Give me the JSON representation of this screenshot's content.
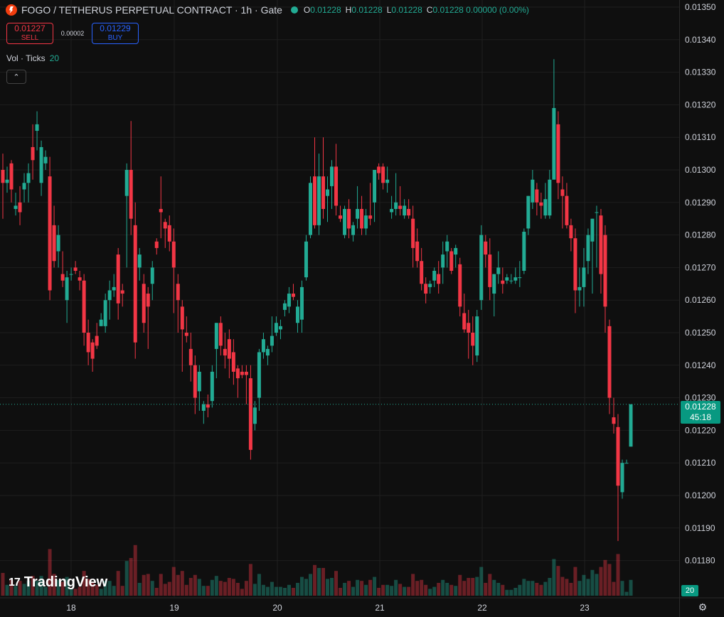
{
  "header": {
    "title": "FOGO / TETHERUS PERPETUAL CONTRACT · 1h · Gate",
    "ohlc": [
      {
        "label": "O",
        "value": "0.01228"
      },
      {
        "label": "H",
        "value": "0.01228"
      },
      {
        "label": "L",
        "value": "0.01228"
      },
      {
        "label": "C",
        "value": "0.01228 0.00000 (0.00%)"
      }
    ]
  },
  "trade": {
    "sell_price": "0.01227",
    "sell_label": "SELL",
    "spread": "0.00002",
    "buy_price": "0.01229",
    "buy_label": "BUY"
  },
  "indicator": {
    "name": "Vol · Ticks",
    "value": "20"
  },
  "collapse_icon": "chevron-up-icon",
  "logo": {
    "mark": "17",
    "text": "TradingView"
  },
  "last_price": {
    "price": "0.01228",
    "countdown": "45:18"
  },
  "volume_badge": "20",
  "settings_icon": "gear-icon",
  "colors": {
    "up": "#22ab94",
    "down": "#f23645",
    "background": "#0f0f0f",
    "grid": "#1f1f1f"
  },
  "chart_data": {
    "type": "candlestick",
    "price_axis": [
      "0.01350",
      "0.01340",
      "0.01330",
      "0.01320",
      "0.01310",
      "0.01300",
      "0.01290",
      "0.01280",
      "0.01270",
      "0.01260",
      "0.01250",
      "0.01240",
      "0.01230",
      "0.01220",
      "0.01210",
      "0.01200",
      "0.01190",
      "0.01180"
    ],
    "ylim": [
      0.01172,
      0.01352
    ],
    "time_axis": [
      "18",
      "19",
      "20",
      "21",
      "22",
      "23"
    ],
    "candles": [
      [
        0.013,
        0.01305,
        0.01285,
        0.01296
      ],
      [
        0.01296,
        0.01301,
        0.01293,
        0.01297
      ],
      [
        0.01302,
        0.01303,
        0.0129,
        0.01294
      ],
      [
        0.01288,
        0.01293,
        0.01286,
        0.01289
      ],
      [
        0.0129,
        0.01295,
        0.01283,
        0.01287
      ],
      [
        0.01294,
        0.01299,
        0.0129,
        0.01296
      ],
      [
        0.01296,
        0.01302,
        0.0129,
        0.01299
      ],
      [
        0.01307,
        0.01314,
        0.01297,
        0.01303
      ],
      [
        0.01312,
        0.01318,
        0.01306,
        0.01314
      ],
      [
        0.01296,
        0.01309,
        0.01292,
        0.01307
      ],
      [
        0.01302,
        0.01306,
        0.013,
        0.01304
      ],
      [
        0.01298,
        0.01304,
        0.0126,
        0.01263
      ],
      [
        0.01283,
        0.01289,
        0.0127,
        0.01272
      ],
      [
        0.01275,
        0.01283,
        0.0127,
        0.0128
      ],
      [
        0.01268,
        0.01275,
        0.01264,
        0.01266
      ],
      [
        0.0126,
        0.01269,
        0.01253,
        0.01267
      ],
      [
        0.01268,
        0.0127,
        0.01266,
        0.01268
      ],
      [
        0.0127,
        0.01272,
        0.01268,
        0.01269
      ],
      [
        0.01267,
        0.01269,
        0.01263,
        0.01266
      ],
      [
        0.01266,
        0.01268,
        0.01246,
        0.0125
      ],
      [
        0.0125,
        0.01254,
        0.0124,
        0.01244
      ],
      [
        0.01247,
        0.01248,
        0.01238,
        0.01242
      ],
      [
        0.01249,
        0.01253,
        0.01245,
        0.01246
      ],
      [
        0.01252,
        0.01256,
        0.01252,
        0.01254
      ],
      [
        0.01252,
        0.01262,
        0.0125,
        0.0126
      ],
      [
        0.0126,
        0.01266,
        0.01254,
        0.01263
      ],
      [
        0.01263,
        0.01268,
        0.01261,
        0.01264
      ],
      [
        0.01274,
        0.01276,
        0.01254,
        0.01259
      ],
      [
        0.01263,
        0.01265,
        0.01258,
        0.01262
      ],
      [
        0.01292,
        0.01302,
        0.0127,
        0.013
      ],
      [
        0.013,
        0.01315,
        0.0128,
        0.01285
      ],
      [
        0.01283,
        0.0129,
        0.01242,
        0.01247
      ],
      [
        0.0127,
        0.01276,
        0.01266,
        0.01274
      ],
      [
        0.01265,
        0.01268,
        0.0125,
        0.01253
      ],
      [
        0.01262,
        0.01264,
        0.01245,
        0.01258
      ],
      [
        0.01265,
        0.01272,
        0.0126,
        0.0127
      ],
      [
        0.01278,
        0.01279,
        0.01274,
        0.01276
      ],
      [
        0.01288,
        0.01298,
        0.01279,
        0.01287
      ],
      [
        0.01284,
        0.01285,
        0.01276,
        0.01282
      ],
      [
        0.01283,
        0.01286,
        0.01275,
        0.01278
      ],
      [
        0.01278,
        0.01282,
        0.01256,
        0.0127
      ],
      [
        0.01265,
        0.01268,
        0.0125,
        0.0126
      ],
      [
        0.01258,
        0.0126,
        0.01238,
        0.01251
      ],
      [
        0.0125,
        0.01255,
        0.01247,
        0.01249
      ],
      [
        0.01245,
        0.0125,
        0.01235,
        0.0124
      ],
      [
        0.0124,
        0.01243,
        0.01225,
        0.0123
      ],
      [
        0.01232,
        0.0124,
        0.01226,
        0.01238
      ],
      [
        0.01226,
        0.01229,
        0.01222,
        0.01228
      ],
      [
        0.01228,
        0.01231,
        0.01224,
        0.01227
      ],
      [
        0.01229,
        0.0124,
        0.01227,
        0.01238
      ],
      [
        0.01245,
        0.01253,
        0.01236,
        0.01253
      ],
      [
        0.01253,
        0.01255,
        0.01243,
        0.01246
      ],
      [
        0.01245,
        0.0125,
        0.01239,
        0.01243
      ],
      [
        0.01248,
        0.01251,
        0.01236,
        0.01242
      ],
      [
        0.01244,
        0.01248,
        0.01234,
        0.01238
      ],
      [
        0.01239,
        0.0124,
        0.0123,
        0.01236
      ],
      [
        0.01238,
        0.0124,
        0.01236,
        0.01237
      ],
      [
        0.01238,
        0.0124,
        0.01228,
        0.01237
      ],
      [
        0.01236,
        0.0124,
        0.01211,
        0.01214
      ],
      [
        0.01222,
        0.01229,
        0.0122,
        0.01227
      ],
      [
        0.0123,
        0.01245,
        0.01226,
        0.01244
      ],
      [
        0.01244,
        0.0125,
        0.01242,
        0.01248
      ],
      [
        0.01243,
        0.01246,
        0.0124,
        0.01245
      ],
      [
        0.01246,
        0.01255,
        0.01244,
        0.01249
      ],
      [
        0.0125,
        0.01255,
        0.01249,
        0.01253
      ],
      [
        0.01251,
        0.01254,
        0.01248,
        0.01252
      ],
      [
        0.01257,
        0.0126,
        0.01255,
        0.01259
      ],
      [
        0.01258,
        0.01264,
        0.01256,
        0.01262
      ],
      [
        0.01262,
        0.01265,
        0.0126,
        0.01261
      ],
      [
        0.01253,
        0.0126,
        0.0125,
        0.01258
      ],
      [
        0.01254,
        0.01266,
        0.0125,
        0.01264
      ],
      [
        0.01267,
        0.0128,
        0.01266,
        0.01278
      ],
      [
        0.0128,
        0.01298,
        0.01279,
        0.01296
      ],
      [
        0.01298,
        0.0131,
        0.01282,
        0.01283
      ],
      [
        0.01283,
        0.01305,
        0.0128,
        0.01298
      ],
      [
        0.01298,
        0.0131,
        0.01285,
        0.01288
      ],
      [
        0.01292,
        0.01298,
        0.01284,
        0.01294
      ],
      [
        0.01295,
        0.01303,
        0.01288,
        0.01301
      ],
      [
        0.01301,
        0.01308,
        0.01286,
        0.01289
      ],
      [
        0.01286,
        0.01289,
        0.01284,
        0.01285
      ],
      [
        0.0128,
        0.01289,
        0.01279,
        0.01288
      ],
      [
        0.01288,
        0.01291,
        0.01279,
        0.01282
      ],
      [
        0.0128,
        0.01284,
        0.01278,
        0.01283
      ],
      [
        0.01285,
        0.01295,
        0.01282,
        0.01288
      ],
      [
        0.01288,
        0.01292,
        0.0128,
        0.01282
      ],
      [
        0.01282,
        0.01288,
        0.0128,
        0.01286
      ],
      [
        0.01286,
        0.01296,
        0.01283,
        0.01285
      ],
      [
        0.0129,
        0.013,
        0.01284,
        0.013
      ],
      [
        0.01301,
        0.01302,
        0.01297,
        0.01299
      ],
      [
        0.01301,
        0.01302,
        0.01294,
        0.01296
      ],
      [
        0.01296,
        0.01301,
        0.01293,
        0.01297
      ],
      [
        0.01287,
        0.01292,
        0.01285,
        0.01288
      ],
      [
        0.01288,
        0.01299,
        0.01286,
        0.0129
      ],
      [
        0.01289,
        0.01295,
        0.01286,
        0.01288
      ],
      [
        0.01286,
        0.01291,
        0.01285,
        0.01289
      ],
      [
        0.01288,
        0.01291,
        0.01285,
        0.01286
      ],
      [
        0.01285,
        0.01289,
        0.0127,
        0.01276
      ],
      [
        0.01278,
        0.01282,
        0.0127,
        0.01272
      ],
      [
        0.01272,
        0.01276,
        0.01263,
        0.01265
      ],
      [
        0.01265,
        0.01267,
        0.01259,
        0.01262
      ],
      [
        0.01264,
        0.01266,
        0.01262,
        0.01265
      ],
      [
        0.01266,
        0.0127,
        0.01264,
        0.01269
      ],
      [
        0.01268,
        0.01272,
        0.01262,
        0.01265
      ],
      [
        0.0127,
        0.01278,
        0.01265,
        0.01274
      ],
      [
        0.01275,
        0.0128,
        0.0127,
        0.01278
      ],
      [
        0.01275,
        0.01276,
        0.01268,
        0.01269
      ],
      [
        0.01274,
        0.01277,
        0.0127,
        0.01276
      ],
      [
        0.01271,
        0.01273,
        0.01255,
        0.01258
      ],
      [
        0.01256,
        0.01262,
        0.0125,
        0.01251
      ],
      [
        0.01253,
        0.01257,
        0.01242,
        0.0125
      ],
      [
        0.0125,
        0.01255,
        0.0124,
        0.01246
      ],
      [
        0.01243,
        0.01257,
        0.01241,
        0.01255
      ],
      [
        0.0126,
        0.01283,
        0.01257,
        0.0128
      ],
      [
        0.01278,
        0.0128,
        0.0127,
        0.01274
      ],
      [
        0.01274,
        0.01279,
        0.0126,
        0.01264
      ],
      [
        0.01262,
        0.01268,
        0.01255,
        0.01268
      ],
      [
        0.01268,
        0.01275,
        0.01265,
        0.0127
      ],
      [
        0.01266,
        0.0127,
        0.01262,
        0.01265
      ],
      [
        0.01266,
        0.01268,
        0.01265,
        0.01267
      ],
      [
        0.01266,
        0.01268,
        0.01265,
        0.01266
      ],
      [
        0.01266,
        0.0127,
        0.01265,
        0.01267
      ],
      [
        0.01267,
        0.01272,
        0.01264,
        0.01267
      ],
      [
        0.01269,
        0.01282,
        0.01268,
        0.01281
      ],
      [
        0.01282,
        0.01292,
        0.0128,
        0.01292
      ],
      [
        0.0129,
        0.013,
        0.01288,
        0.01297
      ],
      [
        0.01294,
        0.01296,
        0.01286,
        0.0129
      ],
      [
        0.0129,
        0.01293,
        0.01285,
        0.01289
      ],
      [
        0.01286,
        0.01296,
        0.01285,
        0.01291
      ],
      [
        0.01286,
        0.013,
        0.01285,
        0.01297
      ],
      [
        0.01297,
        0.01334,
        0.013,
        0.01319
      ],
      [
        0.01314,
        0.01318,
        0.01291,
        0.01296
      ],
      [
        0.01294,
        0.01298,
        0.01282,
        0.01292
      ],
      [
        0.01292,
        0.01296,
        0.01282,
        0.01283
      ],
      [
        0.01283,
        0.01285,
        0.01275,
        0.01279
      ],
      [
        0.01279,
        0.01282,
        0.01256,
        0.01263
      ],
      [
        0.01263,
        0.0127,
        0.01258,
        0.01264
      ],
      [
        0.01264,
        0.01276,
        0.01258,
        0.0127
      ],
      [
        0.01272,
        0.01282,
        0.01268,
        0.0128
      ],
      [
        0.01278,
        0.01285,
        0.01262,
        0.01285
      ],
      [
        0.01287,
        0.01289,
        0.0127,
        0.01287
      ],
      [
        0.01286,
        0.01288,
        0.01262,
        0.01268
      ],
      [
        0.0128,
        0.01283,
        0.0125,
        0.01258
      ],
      [
        0.01252,
        0.01254,
        0.01225,
        0.0123
      ],
      [
        0.01224,
        0.0123,
        0.01219,
        0.01222
      ],
      [
        0.01221,
        0.01225,
        0.01186,
        0.01203
      ],
      [
        0.01201,
        0.01211,
        0.01199,
        0.0121
      ],
      [
        0.0121,
        0.01211,
        0.0121,
        0.0121
      ],
      [
        0.01215,
        0.01228,
        0.01215,
        0.01228
      ]
    ],
    "volume_max_label": "20"
  }
}
